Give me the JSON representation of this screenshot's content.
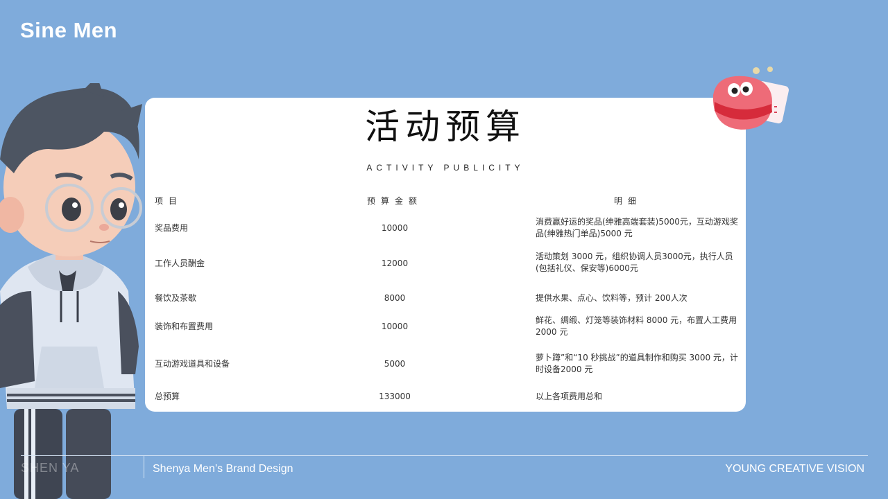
{
  "brand": "Sine Men",
  "card": {
    "title": "活动预算",
    "subtitle": "ACTIVITY PUBLICITY"
  },
  "table": {
    "headers": {
      "item": "项目",
      "amount": "预算金额",
      "detail": "明细"
    },
    "rows": [
      {
        "item": "奖品费用",
        "amount": "10000",
        "detail": "消费赢好运的奖品(绅雅高端套装)5000元，互动游戏奖品(绅雅热门单品)5000 元"
      },
      {
        "item": "工作人员酬金",
        "amount": "12000",
        "detail": "活动策划 3000 元，组织协调人员3000元，执行人员(包括礼仪、保安等)6000元"
      },
      {
        "item": "餐饮及茶歇",
        "amount": "8000",
        "detail": "提供水果、点心、饮料等，预计 200人次"
      },
      {
        "item": "装饰和布置费用",
        "amount": "10000",
        "detail": "鲜花、绸缎、灯笼等装饰材料 8000 元，布置人工费用2000 元"
      },
      {
        "item": "互动游戏道具和设备",
        "amount": "5000",
        "detail": "萝卜蹲”和“10 秒挑战”的道具制作和购买 3000 元，计时设备2000 元"
      },
      {
        "item": "总预算",
        "amount": "133000",
        "detail": "以上各项费用总和"
      }
    ]
  },
  "footer": {
    "left": "SHEN YA",
    "middle": "Shenya Men’s Brand Design",
    "right": "YOUNG CREATIVE VISION"
  },
  "colors": {
    "background": "#7fabdb",
    "card": "#ffffff"
  }
}
